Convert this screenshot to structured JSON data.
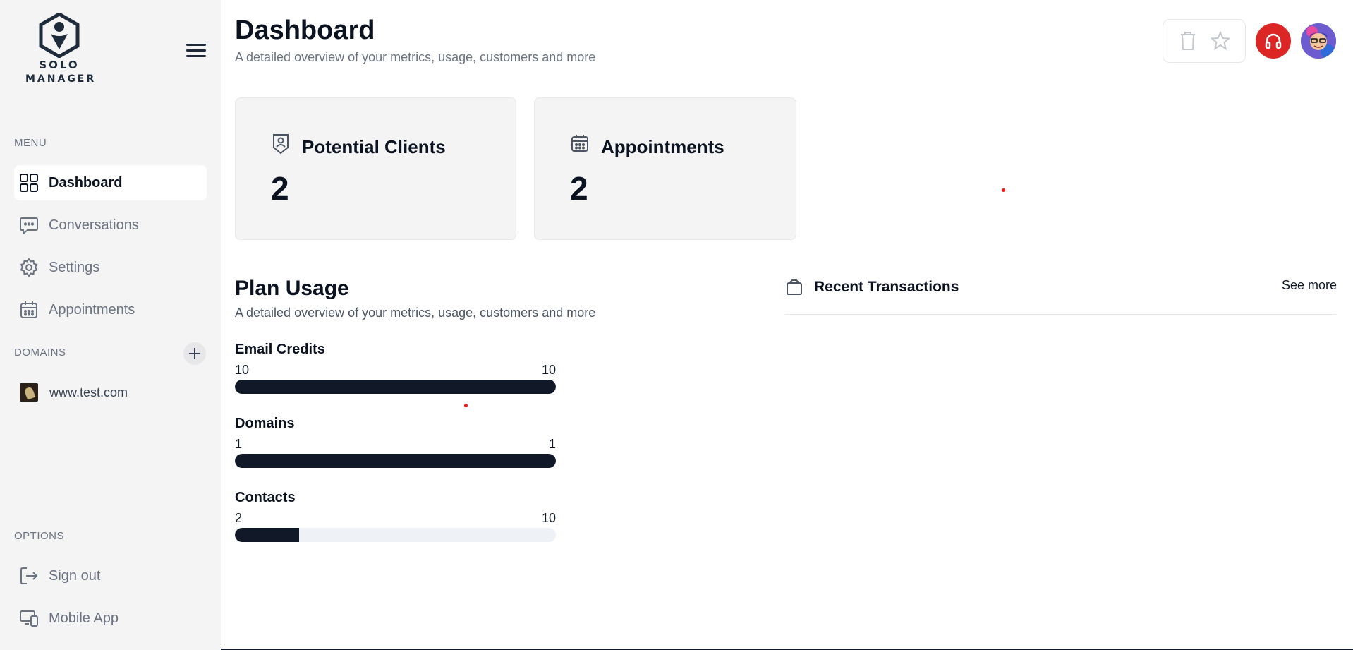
{
  "brand": {
    "line1": "SOLO",
    "line2": "MANAGER",
    "primary": "#1e2b3a"
  },
  "sidebar": {
    "menu_label": "MENU",
    "items": [
      {
        "label": "Dashboard",
        "icon": "grid-icon",
        "active": true
      },
      {
        "label": "Conversations",
        "icon": "chat-bubble-icon",
        "active": false
      },
      {
        "label": "Settings",
        "icon": "gear-icon",
        "active": false
      },
      {
        "label": "Appointments",
        "icon": "calendar-icon",
        "active": false
      }
    ],
    "domains_label": "DOMAINS",
    "domains": [
      {
        "label": "www.test.com",
        "icon": "site-thumbnail"
      }
    ],
    "options_label": "OPTIONS",
    "options": [
      {
        "label": "Sign out",
        "icon": "sign-out-icon"
      },
      {
        "label": "Mobile App",
        "icon": "devices-icon"
      }
    ]
  },
  "header": {
    "title": "Dashboard",
    "subtitle": "A detailed overview of your metrics, usage, customers and more",
    "support_color": "#dc2626"
  },
  "cards": [
    {
      "title": "Potential Clients",
      "value": "2",
      "icon": "user-badge-icon"
    },
    {
      "title": "Appointments",
      "value": "2",
      "icon": "calendar-icon"
    }
  ],
  "plan_usage": {
    "title": "Plan Usage",
    "subtitle": "A detailed overview of your metrics, usage, customers and more",
    "items": [
      {
        "name": "Email Credits",
        "used": "10",
        "limit": "10",
        "fraction": 1.0
      },
      {
        "name": "Domains",
        "used": "1",
        "limit": "1",
        "fraction": 1.0
      },
      {
        "name": "Contacts",
        "used": "2",
        "limit": "10",
        "fraction": 0.2
      }
    ]
  },
  "transactions": {
    "title": "Recent Transactions",
    "see_more": "See more",
    "icon": "wallet-icon"
  }
}
